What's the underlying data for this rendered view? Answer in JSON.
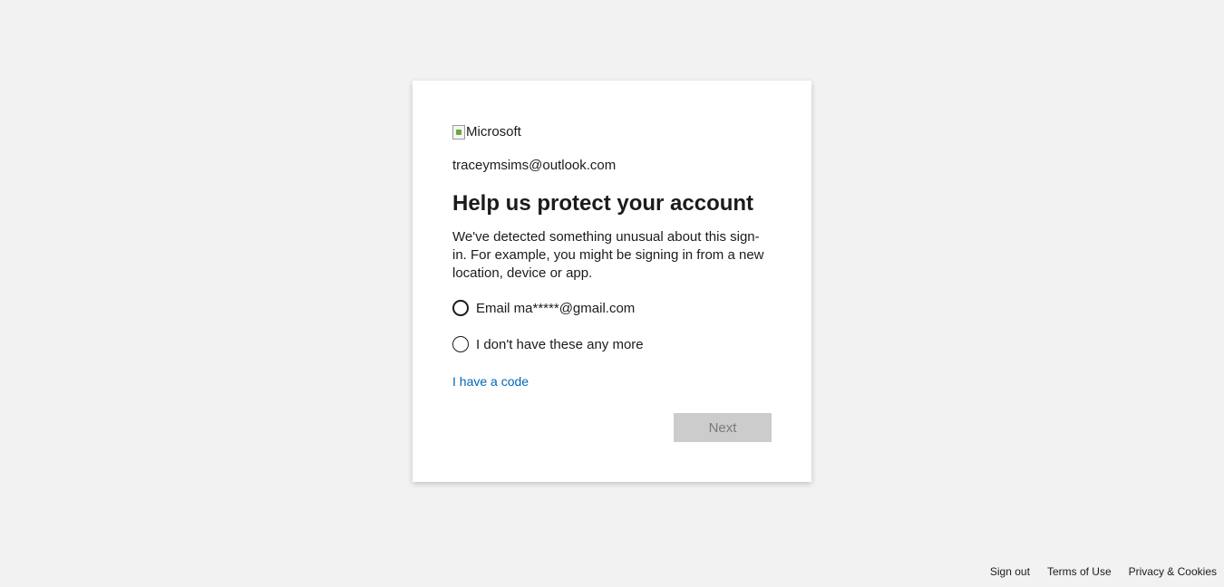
{
  "logo": {
    "alt_text": "Microsoft",
    "icon": "broken-image-icon"
  },
  "account": {
    "email": "traceymsims@outlook.com"
  },
  "heading": "Help us protect your account",
  "description": "We've detected something unusual about this sign-in. For example, you might be signing in from a new location, device or app.",
  "options": [
    {
      "label": "Email ma*****@gmail.com",
      "selected": false
    },
    {
      "label": "I don't have these any more",
      "selected": false
    }
  ],
  "code_link": "I have a code",
  "next_button": {
    "label": "Next",
    "disabled": true
  },
  "footer": {
    "sign_out": "Sign out",
    "terms": "Terms of Use",
    "privacy": "Privacy & Cookies"
  },
  "colors": {
    "background": "#f2f2f2",
    "card": "#ffffff",
    "link": "#0067b8",
    "button_disabled_bg": "#cccccc",
    "button_disabled_text": "#7a7a7a"
  }
}
